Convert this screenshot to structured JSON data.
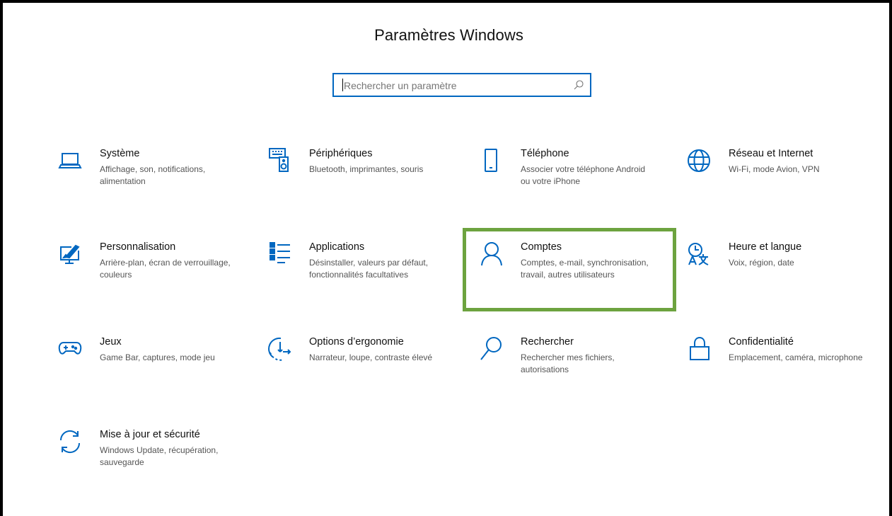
{
  "window": {
    "title": "Paramètres Windows"
  },
  "search": {
    "placeholder": "Rechercher un paramètre",
    "icon": "search-icon"
  },
  "accent_color": "#0067c0",
  "highlight_color": "#6da33f",
  "categories": [
    {
      "icon": "laptop-icon",
      "name": "Système",
      "description": "Affichage, son, notifications, alimentation"
    },
    {
      "icon": "keyboard-speaker-icon",
      "name": "Périphériques",
      "description": "Bluetooth, imprimantes, souris"
    },
    {
      "icon": "phone-icon",
      "name": "Téléphone",
      "description": "Associer votre téléphone Android ou votre iPhone"
    },
    {
      "icon": "globe-icon",
      "name": "Réseau et Internet",
      "description": "Wi-Fi, mode Avion, VPN"
    },
    {
      "icon": "paint-monitor-icon",
      "name": "Personnalisation",
      "description": "Arrière-plan, écran de verrouillage, couleurs"
    },
    {
      "icon": "apps-list-icon",
      "name": "Applications",
      "description": "Désinstaller, valeurs par défaut, fonctionnalités facultatives"
    },
    {
      "icon": "person-icon",
      "name": "Comptes",
      "description": "Comptes, e-mail, synchronisation, travail, autres utilisateurs"
    },
    {
      "icon": "time-language-icon",
      "name": "Heure et langue",
      "description": "Voix, région, date"
    },
    {
      "icon": "gamepad-icon",
      "name": "Jeux",
      "description": "Game Bar, captures, mode jeu"
    },
    {
      "icon": "ease-of-access-icon",
      "name": "Options d’ergonomie",
      "description": "Narrateur, loupe, contraste élevé"
    },
    {
      "icon": "search-icon",
      "name": "Rechercher",
      "description": "Rechercher mes fichiers, autorisations"
    },
    {
      "icon": "lock-icon",
      "name": "Confidentialité",
      "description": "Emplacement, caméra, microphone"
    },
    {
      "icon": "update-sync-icon",
      "name": "Mise à jour et sécurité",
      "description": "Windows Update, récupération, sauvegarde"
    }
  ]
}
